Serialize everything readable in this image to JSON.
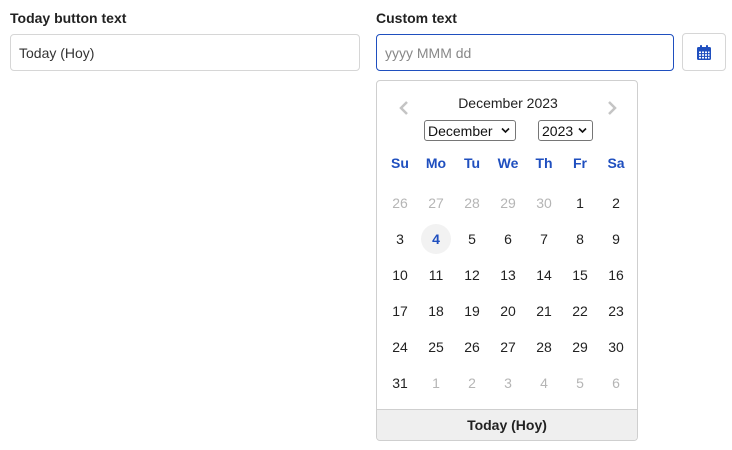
{
  "left_field": {
    "label": "Today button text",
    "value": "Today (Hoy)"
  },
  "right_field": {
    "label": "Custom text",
    "placeholder": "yyyy MMM dd",
    "value": ""
  },
  "icons": {
    "calendar_button": "calendar-icon",
    "prev": "chevron-left-icon",
    "next": "chevron-right-icon"
  },
  "colors": {
    "accent": "#1f4fbf",
    "muted": "#b5b5b5",
    "border": "#d6d6d6",
    "footer_bg": "#efefef"
  },
  "datepicker": {
    "title": "December 2023",
    "month_select": "December",
    "year_select": "2023",
    "weekdays": [
      "Su",
      "Mo",
      "Tu",
      "We",
      "Th",
      "Fr",
      "Sa"
    ],
    "weeks": [
      [
        {
          "d": "26",
          "o": true
        },
        {
          "d": "27",
          "o": true
        },
        {
          "d": "28",
          "o": true
        },
        {
          "d": "29",
          "o": true
        },
        {
          "d": "30",
          "o": true
        },
        {
          "d": "1"
        },
        {
          "d": "2"
        }
      ],
      [
        {
          "d": "3"
        },
        {
          "d": "4",
          "today": true
        },
        {
          "d": "5"
        },
        {
          "d": "6"
        },
        {
          "d": "7"
        },
        {
          "d": "8"
        },
        {
          "d": "9"
        }
      ],
      [
        {
          "d": "10"
        },
        {
          "d": "11"
        },
        {
          "d": "12"
        },
        {
          "d": "13"
        },
        {
          "d": "14"
        },
        {
          "d": "15"
        },
        {
          "d": "16"
        }
      ],
      [
        {
          "d": "17"
        },
        {
          "d": "18"
        },
        {
          "d": "19"
        },
        {
          "d": "20"
        },
        {
          "d": "21"
        },
        {
          "d": "22"
        },
        {
          "d": "23"
        }
      ],
      [
        {
          "d": "24"
        },
        {
          "d": "25"
        },
        {
          "d": "26"
        },
        {
          "d": "27"
        },
        {
          "d": "28"
        },
        {
          "d": "29"
        },
        {
          "d": "30"
        }
      ],
      [
        {
          "d": "31"
        },
        {
          "d": "1",
          "o": true
        },
        {
          "d": "2",
          "o": true
        },
        {
          "d": "3",
          "o": true
        },
        {
          "d": "4",
          "o": true
        },
        {
          "d": "5",
          "o": true
        },
        {
          "d": "6",
          "o": true
        }
      ]
    ],
    "today_button": "Today (Hoy)"
  }
}
